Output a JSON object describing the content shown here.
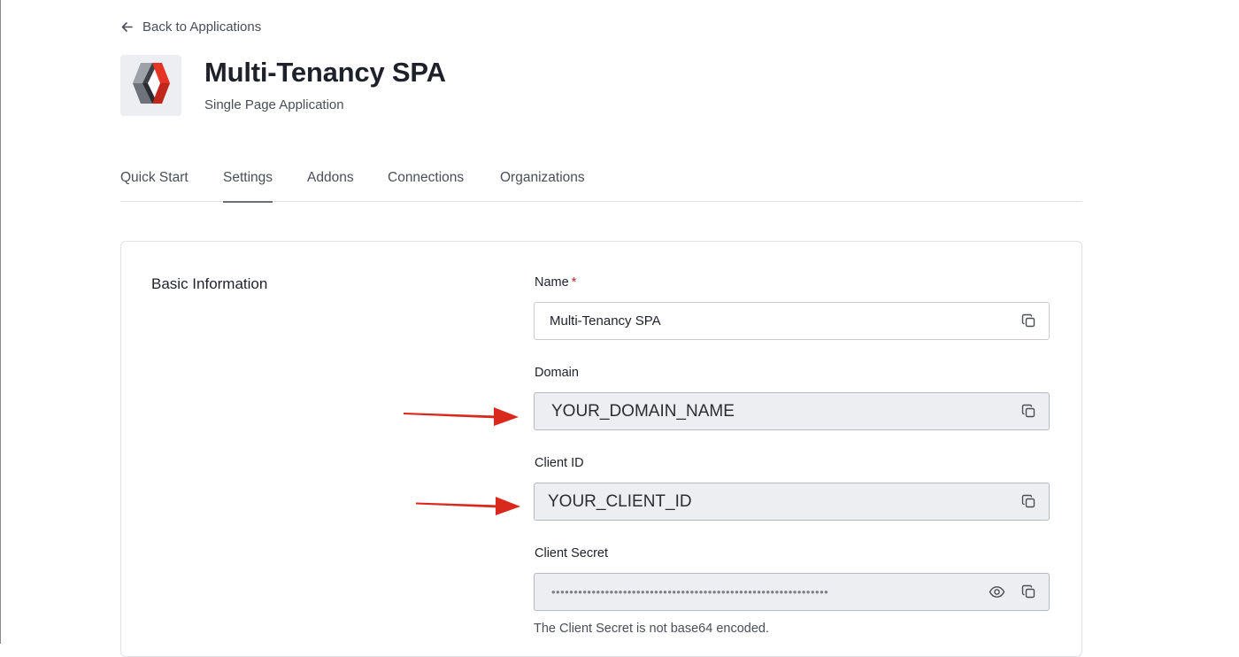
{
  "nav": {
    "back_label": "Back to Applications"
  },
  "app": {
    "title": "Multi-Tenancy SPA",
    "subtitle": "Single Page Application",
    "logo_icon": "application-logo-icon"
  },
  "tabs": [
    {
      "label": "Quick Start",
      "active": false
    },
    {
      "label": "Settings",
      "active": true
    },
    {
      "label": "Addons",
      "active": false
    },
    {
      "label": "Connections",
      "active": false
    },
    {
      "label": "Organizations",
      "active": false
    }
  ],
  "basic_info": {
    "section_title": "Basic Information",
    "name": {
      "label": "Name",
      "required_mark": "*",
      "value": "Multi-Tenancy SPA",
      "icon": "copy-icon"
    },
    "domain": {
      "label": "Domain",
      "value": "YOUR_DOMAIN_NAME",
      "icon": "copy-icon"
    },
    "client_id": {
      "label": "Client ID",
      "value": "YOUR_CLIENT_ID",
      "icon": "copy-icon"
    },
    "client_secret": {
      "label": "Client Secret",
      "value": "••••••••••••••••••••••••••••••••••••••••••••••••••••••••••••••",
      "icons": [
        "eye-icon",
        "copy-icon"
      ],
      "help_text": "The Client Secret is not base64 encoded."
    }
  },
  "colors": {
    "annotation_arrow": "#d9291c",
    "logo_red": "#e53324",
    "logo_gray": "#9da1a8",
    "logo_dark": "#3d4047"
  }
}
